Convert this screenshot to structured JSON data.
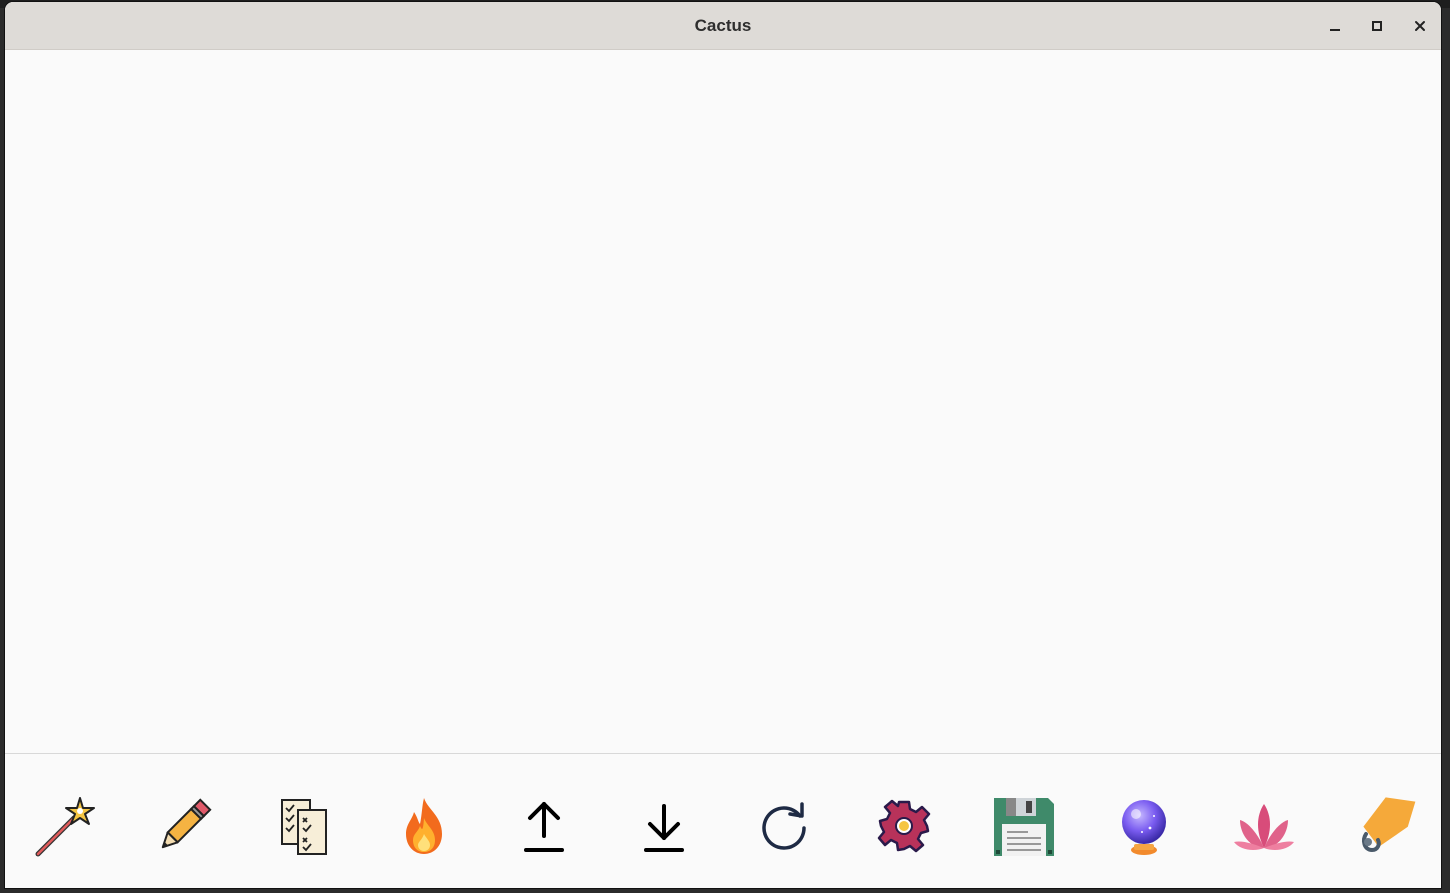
{
  "window": {
    "title": "Cactus"
  },
  "toolbar": {
    "tools": [
      {
        "icon": "magic-wand-icon"
      },
      {
        "icon": "pencil-icon"
      },
      {
        "icon": "checklist-icon"
      },
      {
        "icon": "fire-icon"
      },
      {
        "icon": "upload-icon"
      },
      {
        "icon": "download-icon"
      },
      {
        "icon": "refresh-icon"
      },
      {
        "icon": "gear-icon"
      },
      {
        "icon": "floppy-disk-icon"
      },
      {
        "icon": "crystal-ball-icon"
      },
      {
        "icon": "lotus-icon"
      },
      {
        "icon": "tag-icon"
      }
    ]
  }
}
